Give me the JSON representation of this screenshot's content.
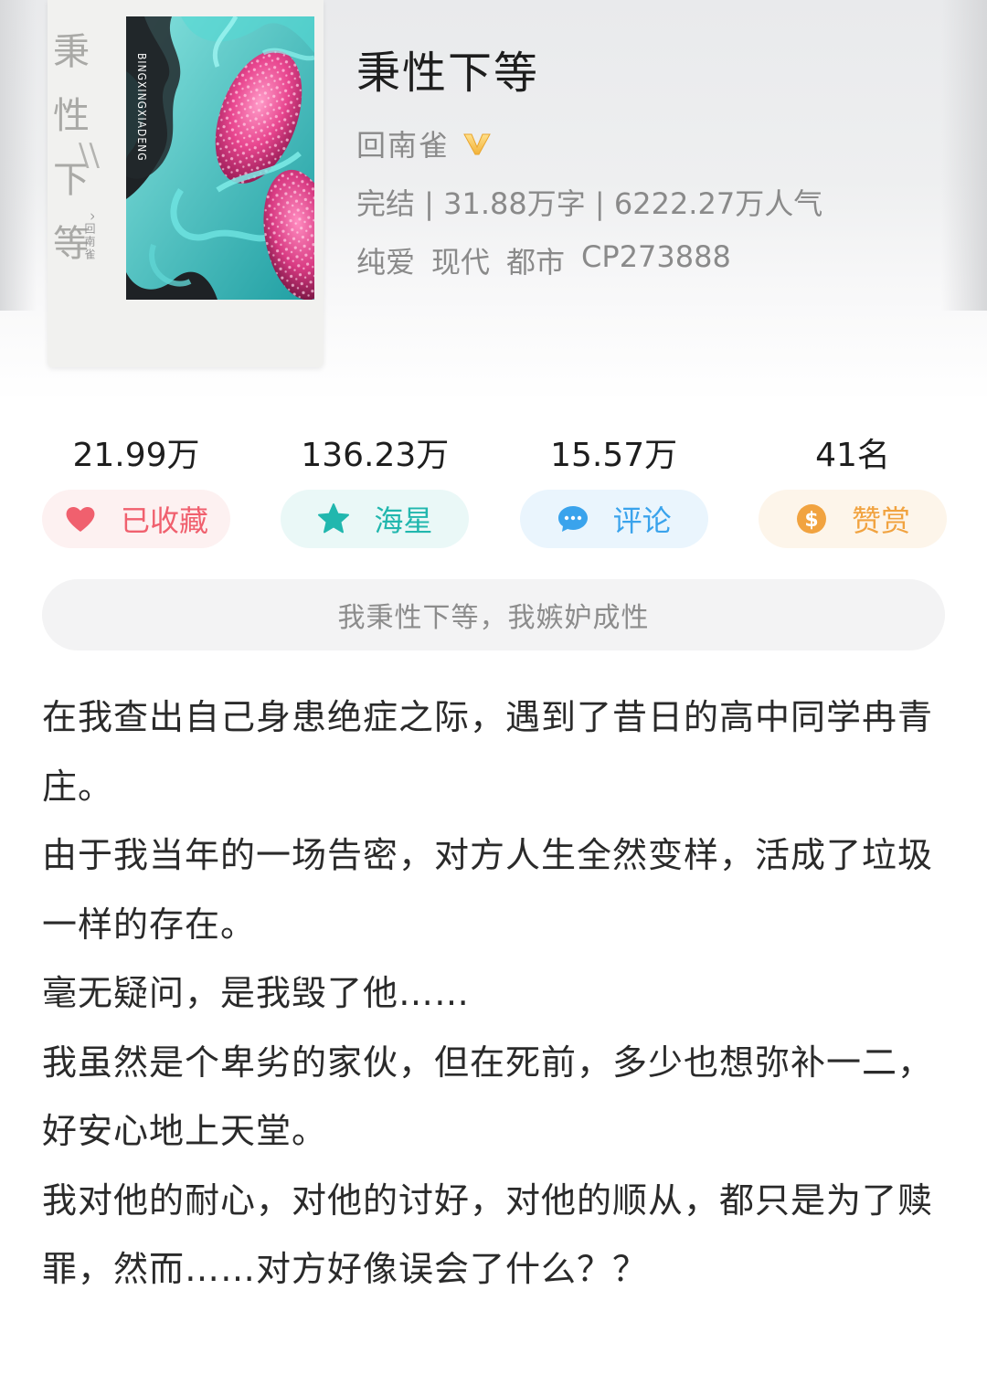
{
  "cover": {
    "vertical_title": [
      "秉性",
      "下等"
    ],
    "pinyin": "BINGXINGXIADENG",
    "author_mark": "^回南雀",
    "slash": "\\\\"
  },
  "book": {
    "title": "秉性下等",
    "author": "回南雀",
    "author_badge_icon": "vip-check-icon",
    "meta": "完结 | 31.88万字 | 6222.27万人气",
    "tags": [
      "纯爱",
      "现代",
      "都市",
      "CP273888"
    ]
  },
  "stats": [
    {
      "value": "21.99万",
      "label": "已收藏",
      "icon": "heart-icon",
      "color": "#f0606e"
    },
    {
      "value": "136.23万",
      "label": "海星",
      "icon": "star-icon",
      "color": "#21b7ae"
    },
    {
      "value": "15.57万",
      "label": "评论",
      "icon": "comment-icon",
      "color": "#3aa3ec"
    },
    {
      "value": "41名",
      "label": "赞赏",
      "icon": "dollar-coin-icon",
      "color": "#f1a340"
    }
  ],
  "slogan": "我秉性下等，我嫉妒成性",
  "description": [
    "在我查出自己身患绝症之际，遇到了昔日的高中同学冉青庄。",
    "由于我当年的一场告密，对方人生全然变样，活成了垃圾一样的存在。",
    "毫无疑问，是我毁了他……",
    "我虽然是个卑劣的家伙，但在死前，多少也想弥补一二，好安心地上天堂。",
    "我对他的耐心，对他的讨好，对他的顺从，都只是为了赎罪，然而……对方好像误会了什么？？"
  ]
}
